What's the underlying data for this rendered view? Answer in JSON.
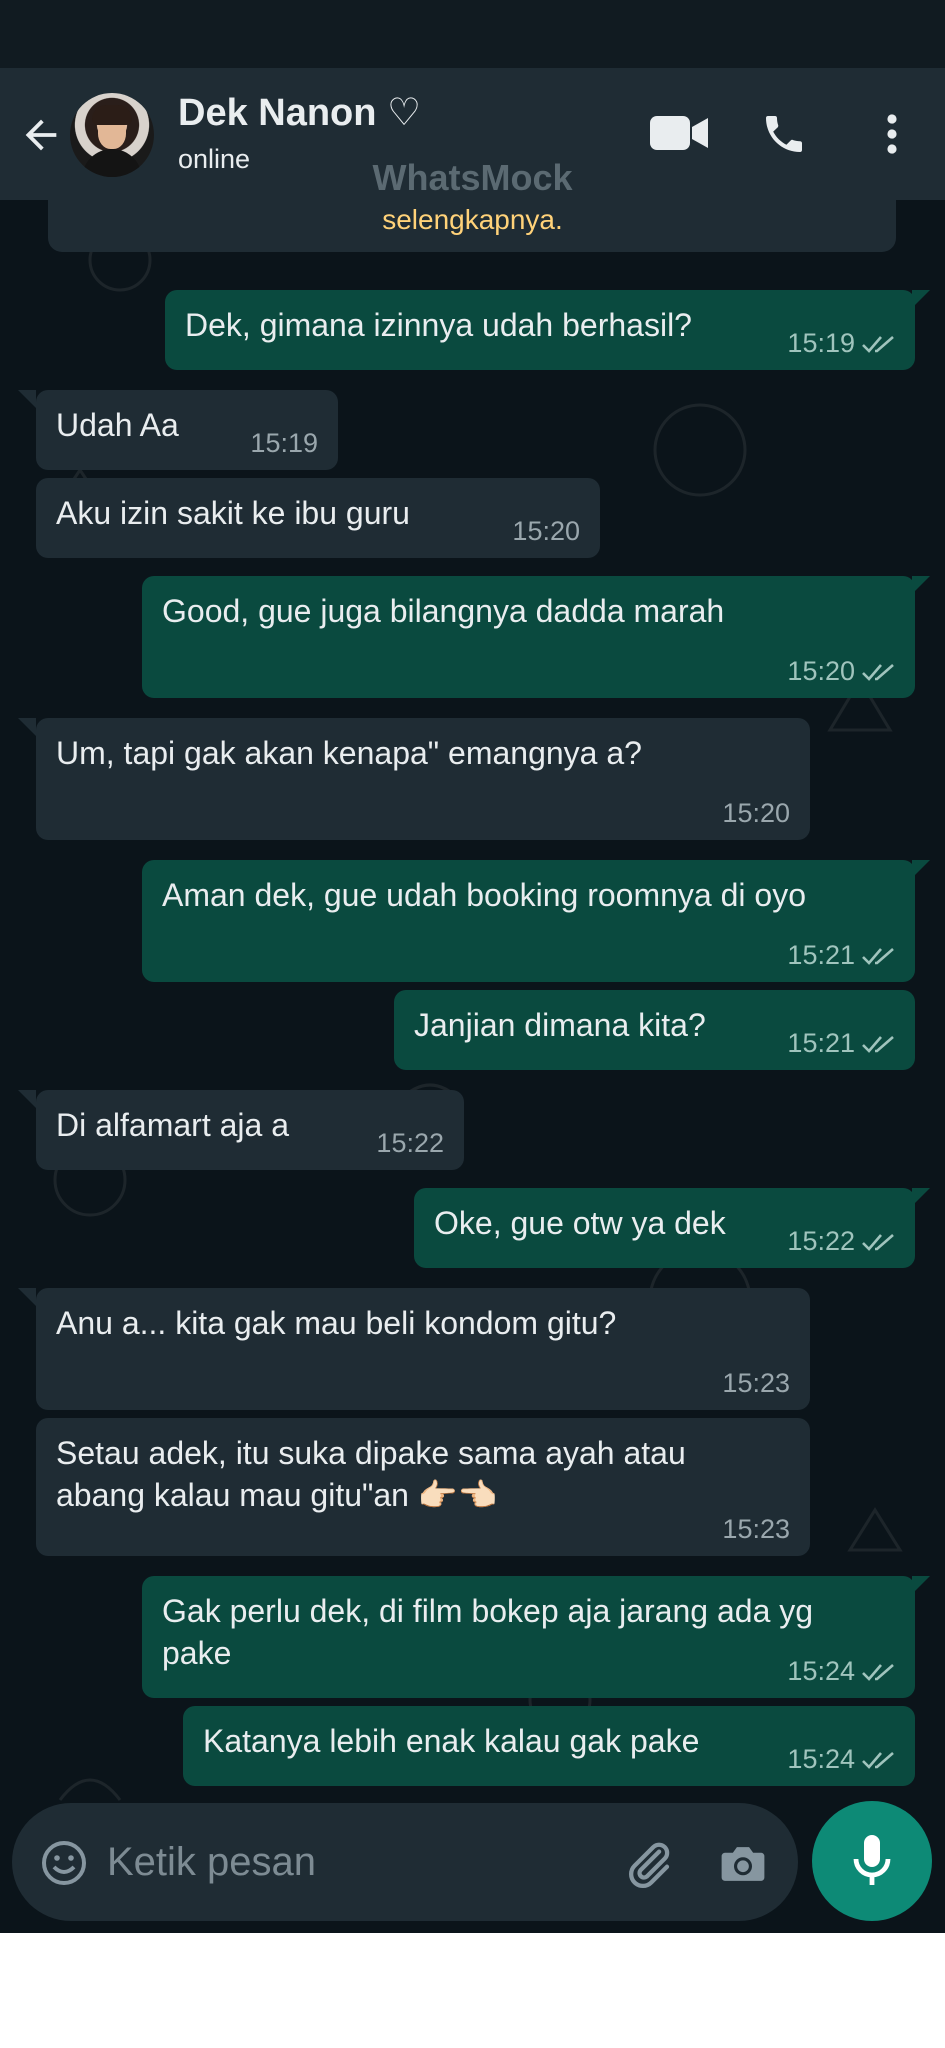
{
  "header": {
    "contact_name": "Dek Nanon ♡",
    "status": "online"
  },
  "watermark": "WhatsMock",
  "system_message": "selengkapnya.",
  "messages": [
    {
      "dir": "out",
      "text": "Dek, gimana izinnya udah berhasil?",
      "time": "15:19",
      "read": true
    },
    {
      "dir": "in",
      "text": "Udah Aa",
      "time": "15:19"
    },
    {
      "dir": "in",
      "text": "Aku izin sakit ke ibu guru",
      "time": "15:20"
    },
    {
      "dir": "out",
      "text": "Good, gue juga bilangnya dadda marah",
      "time": "15:20",
      "read": true
    },
    {
      "dir": "in",
      "text": "Um, tapi gak akan kenapa\" emangnya a?",
      "time": "15:20"
    },
    {
      "dir": "out",
      "text": "Aman dek, gue udah booking roomnya di oyo",
      "time": "15:21",
      "read": true
    },
    {
      "dir": "out",
      "text": "Janjian dimana kita?",
      "time": "15:21",
      "read": true
    },
    {
      "dir": "in",
      "text": "Di alfamart aja a",
      "time": "15:22"
    },
    {
      "dir": "out",
      "text": "Oke, gue otw ya dek",
      "time": "15:22",
      "read": true
    },
    {
      "dir": "in",
      "text": "Anu a... kita gak mau beli kondom gitu?",
      "time": "15:23"
    },
    {
      "dir": "in",
      "text": "Setau adek, itu suka dipake sama ayah atau\nabang kalau mau gitu\"an 👉🏻👈🏻",
      "time": "15:23"
    },
    {
      "dir": "out",
      "text": "Gak perlu dek, di film bokep aja jarang ada yg\npake",
      "time": "15:24",
      "read": true
    },
    {
      "dir": "out",
      "text": "Katanya lebih enak kalau gak pake",
      "time": "15:24",
      "read": true
    }
  ],
  "composer": {
    "placeholder": "Ketik pesan"
  },
  "icons": {
    "back": "arrow-left-icon",
    "video": "video-call-icon",
    "phone": "phone-icon",
    "more": "more-vertical-icon",
    "emoji": "emoji-icon",
    "attach": "paperclip-icon",
    "camera": "camera-icon",
    "mic": "microphone-icon",
    "ticks": "double-check-icon"
  },
  "colors": {
    "header_bg": "#1f2c34",
    "chat_bg": "#0b141a",
    "incoming_bubble": "#1f2c34",
    "outgoing_bubble": "#0a4a3f",
    "accent": "#0d8a76",
    "system_text": "#ffd279"
  }
}
